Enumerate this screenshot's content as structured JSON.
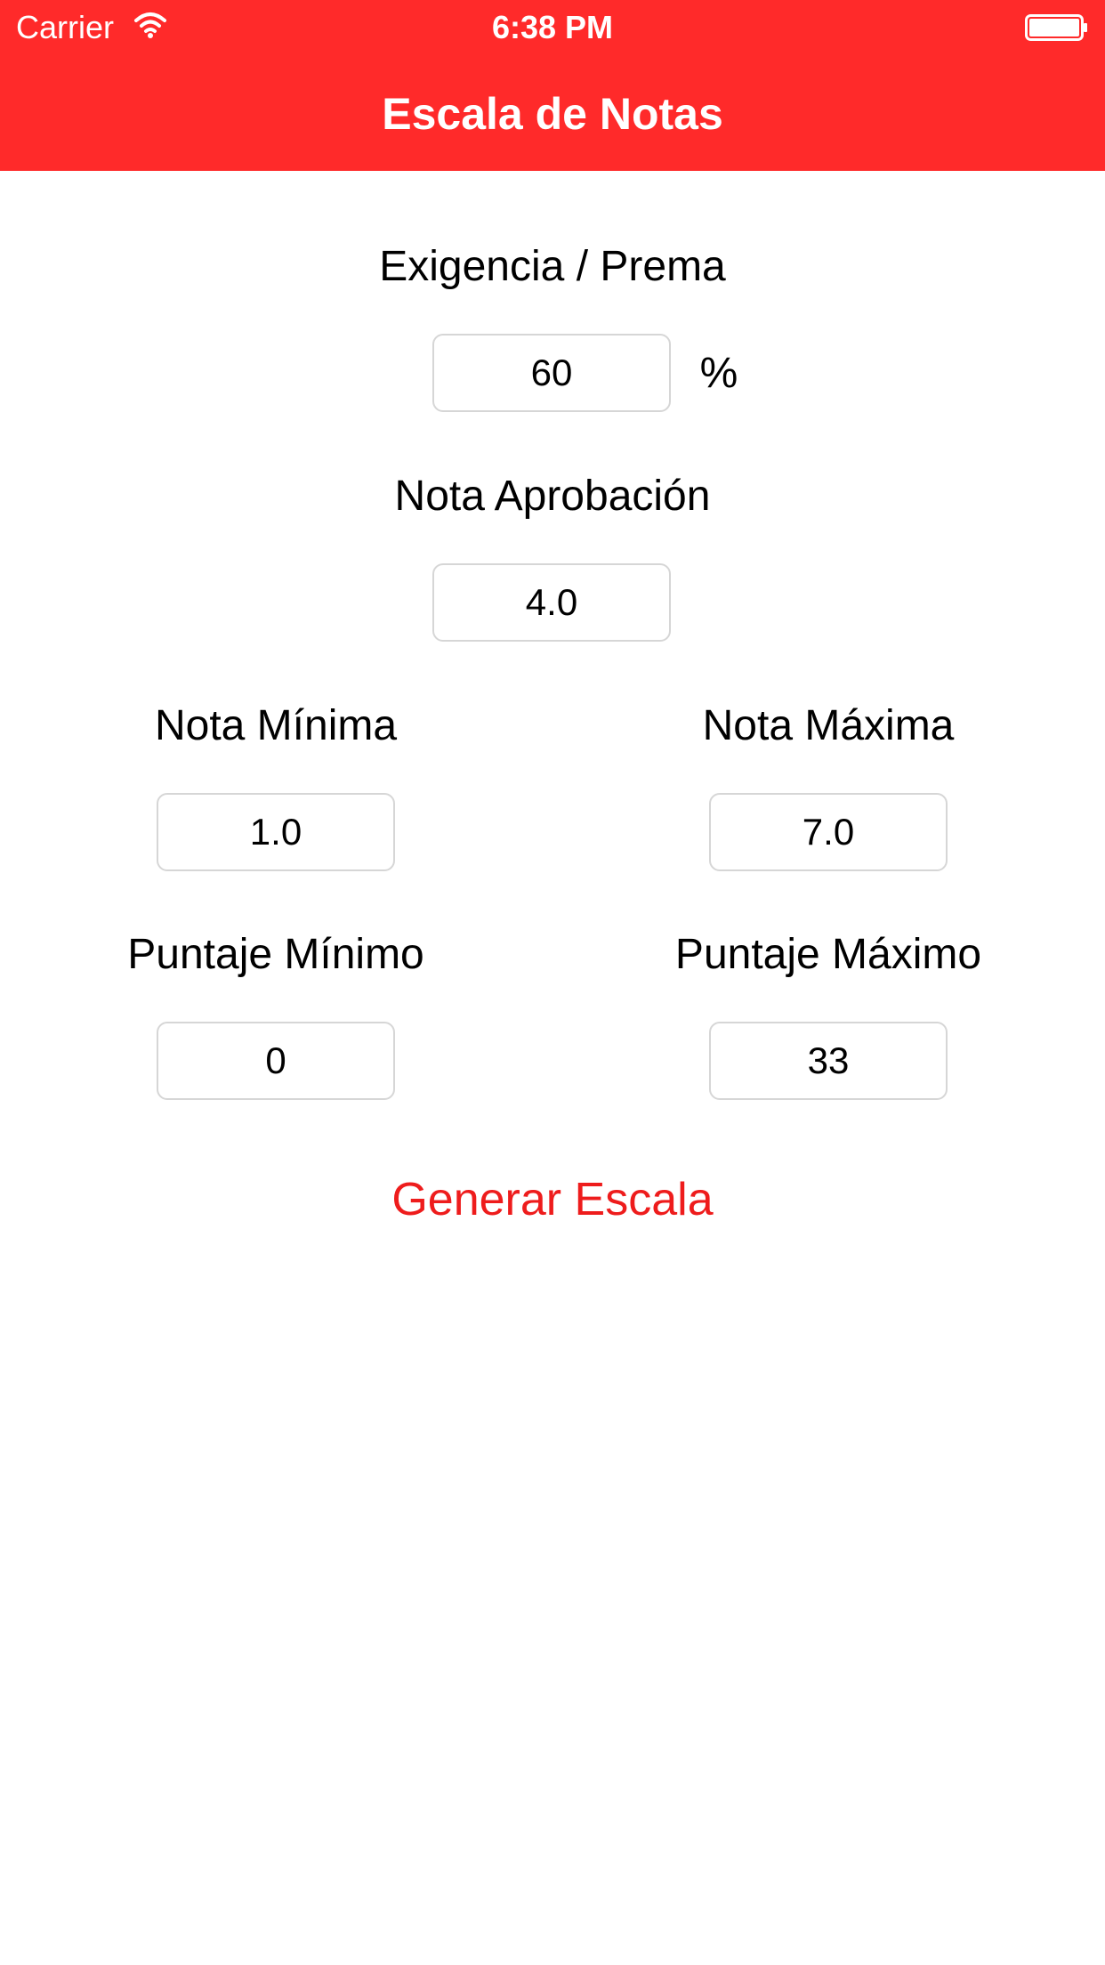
{
  "status_bar": {
    "carrier": "Carrier",
    "time": "6:38 PM",
    "wifi_icon": "wifi-icon",
    "battery_icon": "battery-icon"
  },
  "nav": {
    "title": "Escala de Notas",
    "background_color": "#ff2a2a"
  },
  "form": {
    "exigencia": {
      "label": "Exigencia / Prema",
      "value": "60",
      "unit": "%"
    },
    "nota_aprobacion": {
      "label": "Nota Aprobación",
      "value": "4.0"
    },
    "nota_minima": {
      "label": "Nota Mínima",
      "value": "1.0"
    },
    "nota_maxima": {
      "label": "Nota Máxima",
      "value": "7.0"
    },
    "puntaje_minimo": {
      "label": "Puntaje Mínimo",
      "value": "0"
    },
    "puntaje_maximo": {
      "label": "Puntaje Máximo",
      "value": "33"
    }
  },
  "actions": {
    "generate_label": "Generar Escala",
    "accent_color": "#ee1c1c"
  }
}
